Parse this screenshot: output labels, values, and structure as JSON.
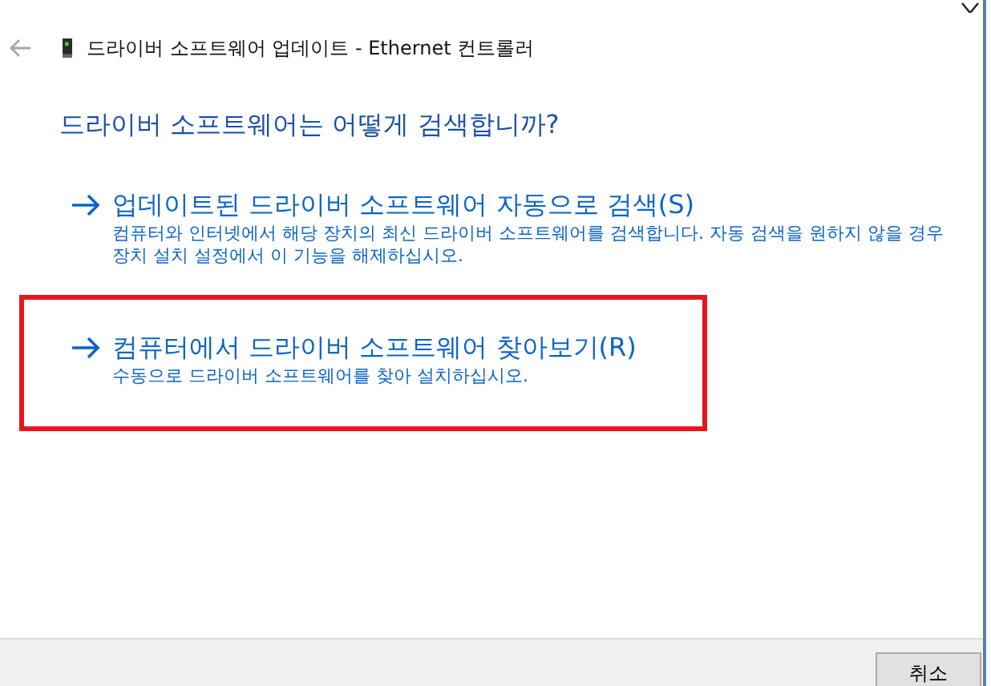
{
  "window": {
    "title": "드라이버 소프트웨어 업데이트 - Ethernet 컨트롤러"
  },
  "heading": "드라이버 소프트웨어는 어떻게 검색합니까?",
  "options": [
    {
      "title": "업데이트된 드라이버 소프트웨어 자동으로 검색(S)",
      "description": "컴퓨터와 인터넷에서 해당 장치의 최신 드라이버 소프트웨어를 검색합니다. 자동 검색을 원하지 않을 경우 장치 설치 설정에서 이 기능을 해제하십시오.",
      "highlighted": false
    },
    {
      "title": "컴퓨터에서 드라이버 소프트웨어 찾아보기(R)",
      "description": "수동으로 드라이버 소프트웨어를 찾아 설치하십시오.",
      "highlighted": true
    }
  ],
  "buttons": [
    "취소"
  ]
}
